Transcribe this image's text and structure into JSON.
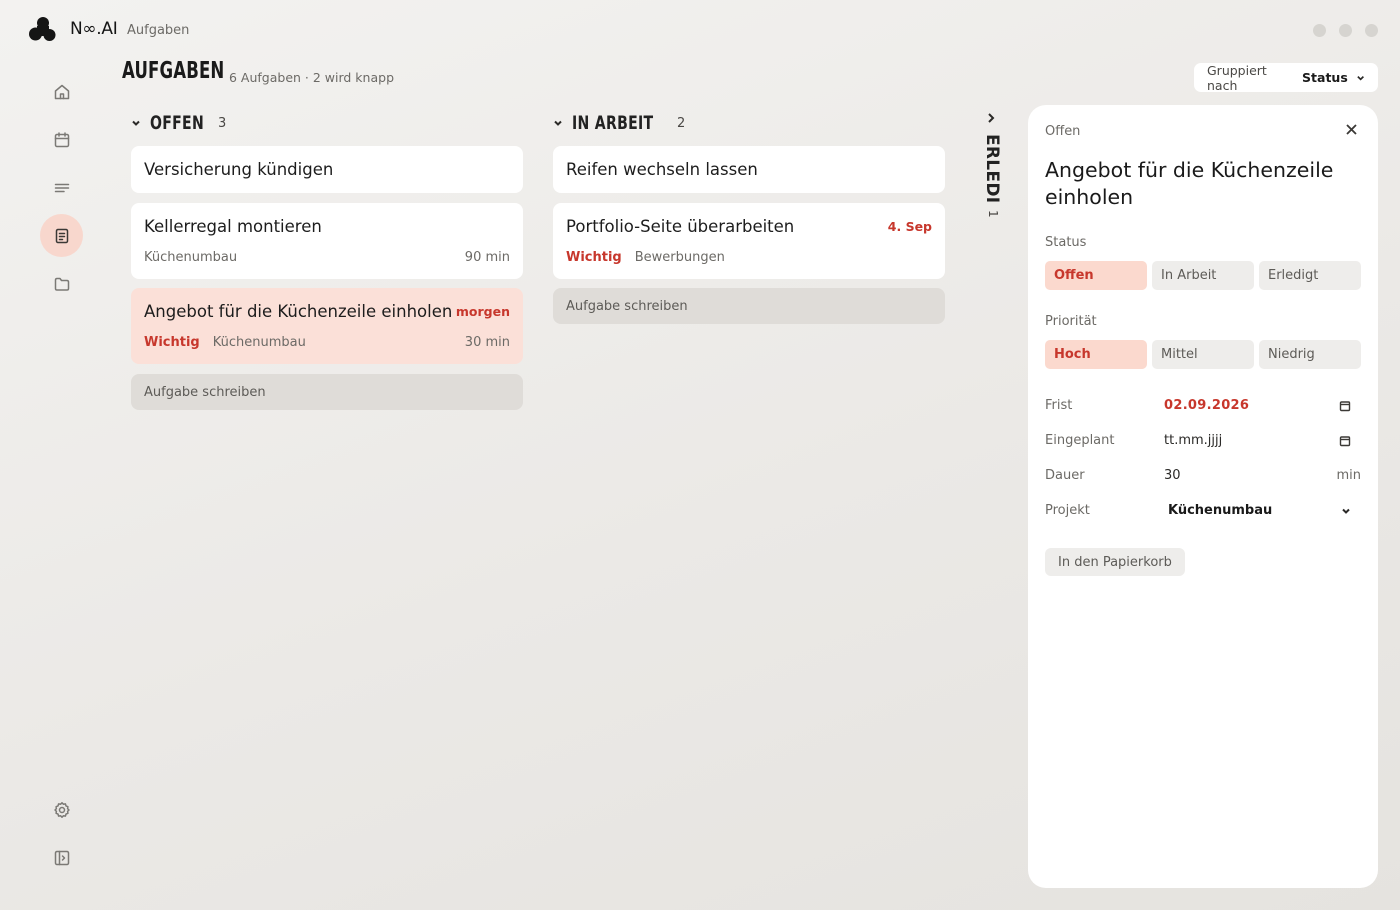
{
  "app": {
    "brand": "N∞.AI",
    "breadcrumb": "Aufgaben"
  },
  "header": {
    "title": "AUFGABEN",
    "subtitle": "6 Aufgaben · 2 wird knapp",
    "group_label": "Gruppiert nach",
    "group_value": "Status"
  },
  "sidebar": {
    "items": [
      {
        "icon": "home-icon"
      },
      {
        "icon": "calendar-icon"
      },
      {
        "icon": "notes-icon"
      },
      {
        "icon": "tasks-icon",
        "active": true
      },
      {
        "icon": "folder-icon"
      }
    ],
    "bottom": [
      {
        "icon": "settings-icon"
      },
      {
        "icon": "sidebar-toggle-icon"
      }
    ]
  },
  "columns": {
    "open": {
      "title": "OFFEN",
      "count": "3",
      "cards": [
        {
          "title": "Versicherung kündigen"
        },
        {
          "title": "Kellerregal montieren",
          "project": "Küchenumbau",
          "duration": "90 min"
        },
        {
          "title": "Angebot für die Küchenzeile einholen",
          "due": "morgen",
          "priority": "Wichtig",
          "project": "Küchenumbau",
          "duration": "30 min"
        }
      ],
      "add_label": "Aufgabe schreiben"
    },
    "in_progress": {
      "title": "IN ARBEIT",
      "count": "2",
      "cards": [
        {
          "title": "Reifen wechseln lassen"
        },
        {
          "title": "Portfolio-Seite überarbeiten",
          "due": "4. Sep",
          "priority": "Wichtig",
          "project": "Bewerbungen"
        }
      ],
      "add_label": "Aufgabe schreiben"
    },
    "done": {
      "title": "ERLEDIGT",
      "count": "1"
    }
  },
  "detail": {
    "status_crumb": "Offen",
    "title": "Angebot für die Küchenzeile einholen",
    "status_label": "Status",
    "status_options": [
      "Offen",
      "In Arbeit",
      "Erledigt"
    ],
    "priority_label": "Priorität",
    "priority_options": [
      "Hoch",
      "Mittel",
      "Niedrig"
    ],
    "deadline_label": "Frist",
    "deadline_value": "02.09.2026",
    "scheduled_label": "Eingeplant",
    "scheduled_value": "tt.mm.jjjj",
    "duration_label": "Dauer",
    "duration_value": "30",
    "duration_unit": "min",
    "project_label": "Projekt",
    "project_value": "Küchenumbau",
    "trash_label": "In den Papierkorb"
  },
  "colors": {
    "accent": "#c7372c",
    "highlight": "#fbe0d8",
    "active_nav": "#f8d7cd"
  }
}
